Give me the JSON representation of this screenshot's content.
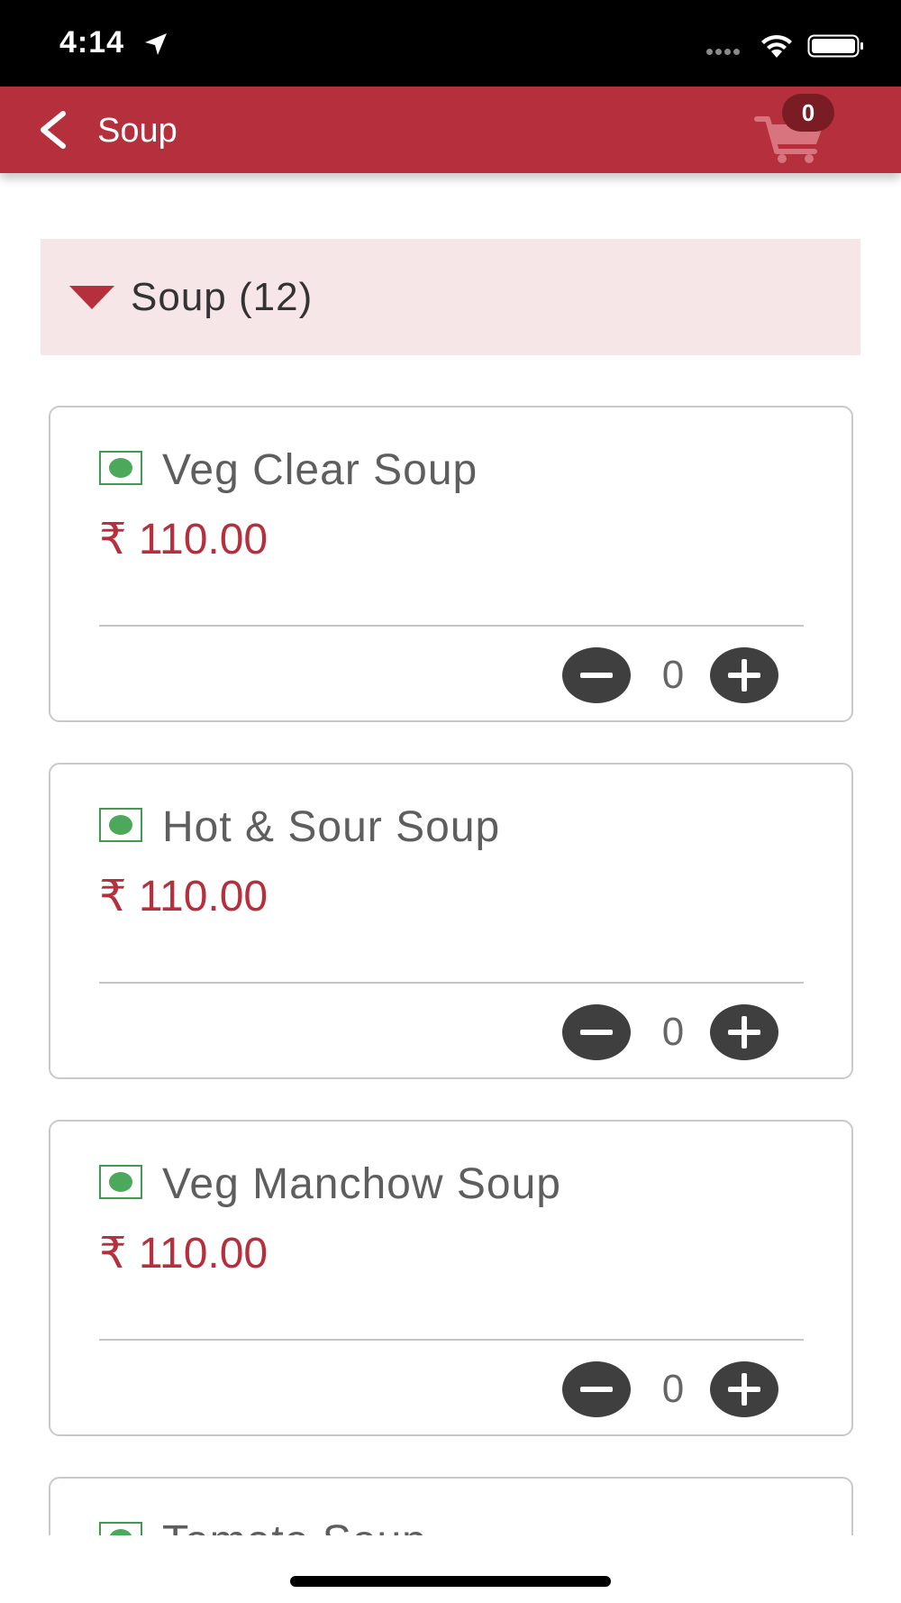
{
  "status_bar": {
    "time": "4:14"
  },
  "nav": {
    "title": "Soup",
    "cart_count": "0",
    "bar_color": "#b5303c"
  },
  "category": {
    "title": "Soup (12)",
    "expanded": true
  },
  "items": [
    {
      "name": "Veg Clear Soup",
      "price": "₹ 110.00",
      "qty": "0",
      "type": "veg"
    },
    {
      "name": "Hot & Sour Soup",
      "price": "₹ 110.00",
      "qty": "0",
      "type": "veg"
    },
    {
      "name": "Veg Manchow Soup",
      "price": "₹ 110.00",
      "qty": "0",
      "type": "veg"
    },
    {
      "name": "Tomato Soup",
      "type": "veg"
    }
  ],
  "icons": {
    "back": "chevron-left-icon",
    "cart": "shopping-cart-icon",
    "veg": "veg-indicator-icon",
    "minus": "minus-circle-icon",
    "plus": "plus-circle-icon"
  }
}
